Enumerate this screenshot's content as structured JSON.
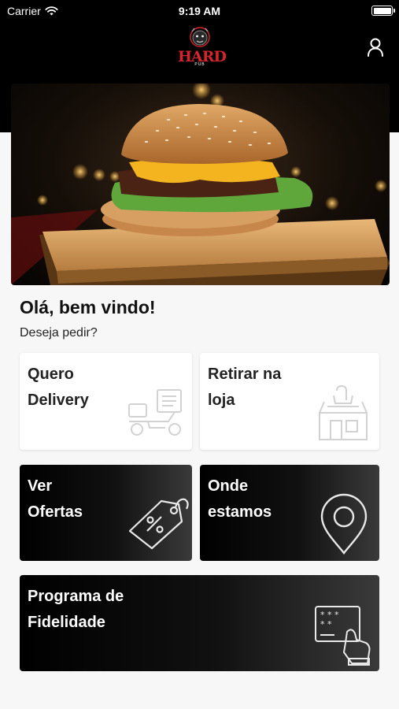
{
  "status_bar": {
    "carrier": "Carrier",
    "time": "9:19 AM",
    "icons": [
      "wifi-icon",
      "battery-icon"
    ]
  },
  "header": {
    "logo_text": "HARD",
    "logo_sub": "PUB",
    "profile_icon": "user-icon"
  },
  "greeting": {
    "title": "Olá, bem vindo!",
    "subtitle": "Deseja pedir?"
  },
  "cards": {
    "delivery": {
      "line1": "Quero",
      "line2": "Delivery",
      "icon": "delivery-scooter-icon"
    },
    "pickup": {
      "line1": "Retirar na",
      "line2": "loja",
      "icon": "store-icon"
    },
    "offers": {
      "line1": "Ver",
      "line2": "Ofertas",
      "icon": "price-tag-icon"
    },
    "location": {
      "line1": "Onde",
      "line2": "estamos",
      "icon": "map-pin-icon"
    },
    "loyalty": {
      "line1": "Programa de",
      "line2": "Fidelidade",
      "icon": "loyalty-card-icon"
    }
  },
  "colors": {
    "brand_red": "#d5242b",
    "header_bg": "#000000",
    "page_bg": "#f7f7f7",
    "card_light": "#ffffff",
    "card_dark": "#111111"
  }
}
